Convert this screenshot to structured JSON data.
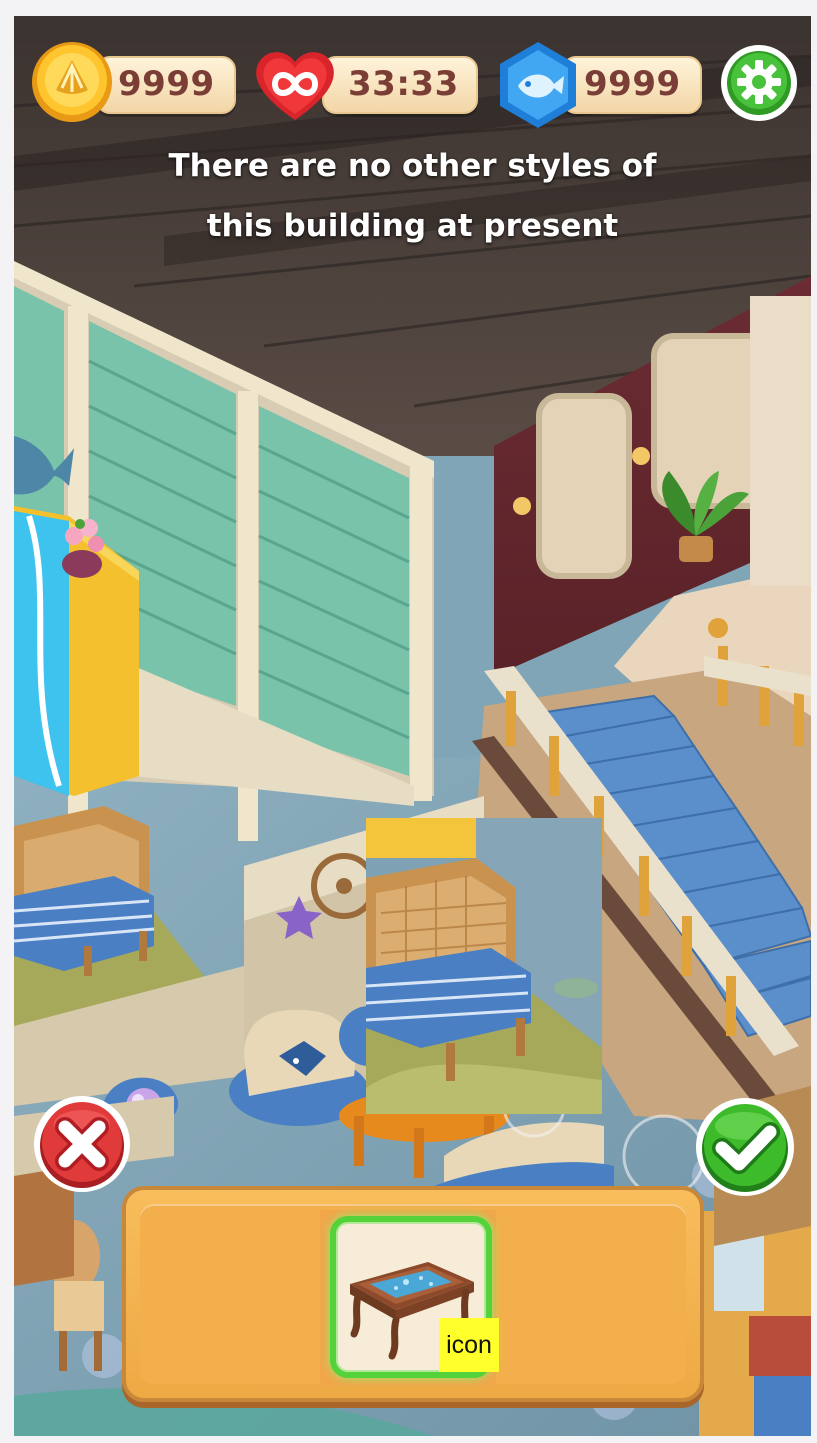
{
  "hud": {
    "coins": "9999",
    "lives_timer": "33:33",
    "fish": "9999"
  },
  "message": {
    "line1": "There are no other styles of",
    "line2": "this building at present"
  },
  "tray": {
    "selected_item_label": "icon"
  },
  "colors": {
    "hud_text": "#7a3e36",
    "tray": "#f3af4c",
    "selected_border": "#53d23a",
    "cancel_button": "#e03a3a",
    "confirm_button": "#3dbb2b",
    "settings_button": "#3dbb2b"
  },
  "icons": {
    "coin": "shell-coin-icon",
    "lives": "infinite-heart-icon",
    "fish": "fish-gem-icon",
    "settings": "gear-icon",
    "cancel": "close-icon",
    "confirm": "checkmark-icon",
    "item": "coffee-table-icon"
  }
}
